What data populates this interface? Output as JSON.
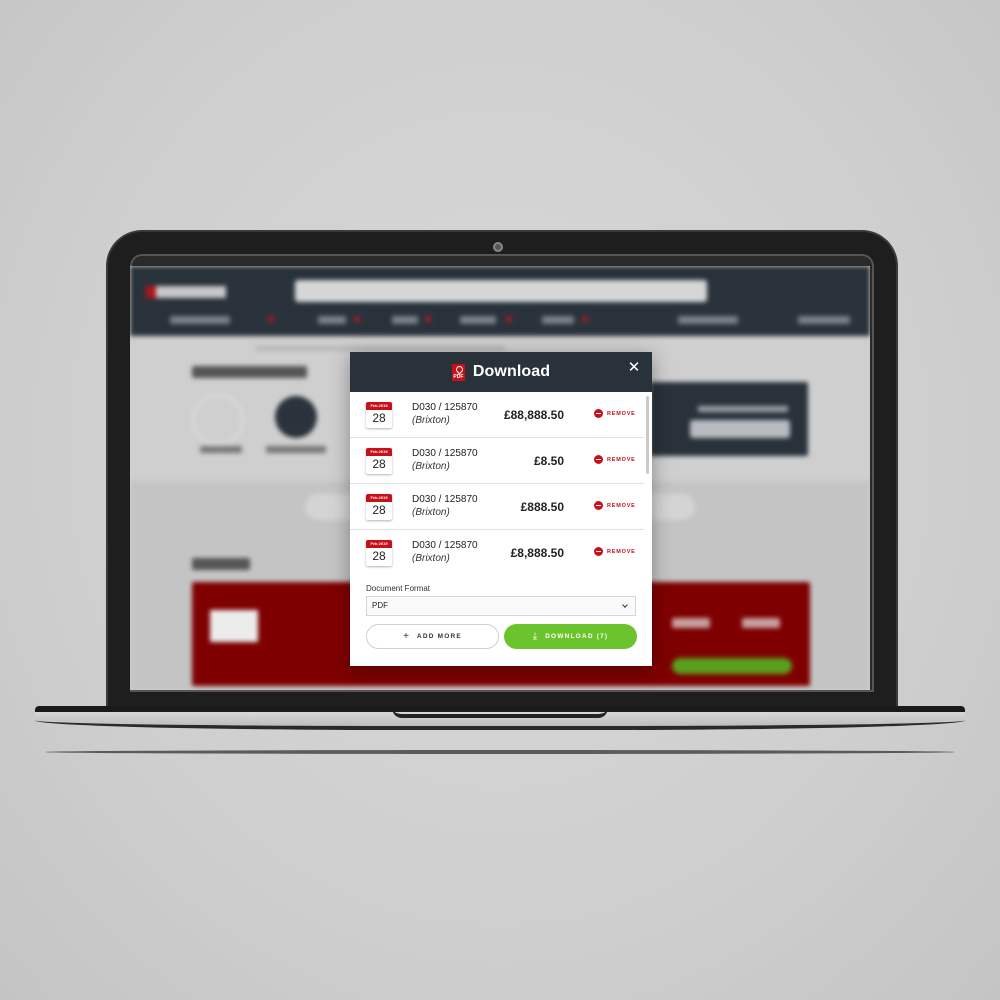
{
  "modal": {
    "title": "Download",
    "title_icon": "pdf-icon",
    "close_icon": "close-icon",
    "close_glyph": "✕",
    "items": [
      {
        "month_year": "Feb 2019",
        "day": "28",
        "reference": "D030 / 125870",
        "branch": "(Brixton)",
        "amount": "£88,888.50",
        "remove_label": "REMOVE"
      },
      {
        "month_year": "Feb 2019",
        "day": "28",
        "reference": "D030 / 125870",
        "branch": "(Brixton)",
        "amount": "£8.50",
        "remove_label": "REMOVE"
      },
      {
        "month_year": "Feb 2019",
        "day": "28",
        "reference": "D030 / 125870",
        "branch": "(Brixton)",
        "amount": "£888.50",
        "remove_label": "REMOVE"
      },
      {
        "month_year": "Feb 2019",
        "day": "28",
        "reference": "D030 / 125870",
        "branch": "(Brixton)",
        "amount": "£8,888.50",
        "remove_label": "REMOVE"
      }
    ],
    "format": {
      "label": "Document Format",
      "selected": "PDF"
    },
    "add_more": {
      "icon": "+",
      "label": "ADD MORE"
    },
    "download": {
      "icon": "⤓",
      "label": "DOWNLOAD (7)"
    }
  },
  "colors": {
    "header": "#29323b",
    "accent_red": "#c8101b",
    "download_green": "#6cc42d",
    "overdue_card": "#7f0000"
  }
}
